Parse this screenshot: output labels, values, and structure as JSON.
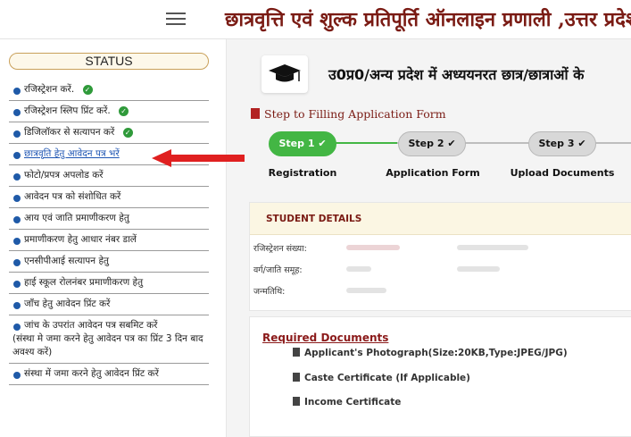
{
  "header": {
    "title": "छात्रवृत्ति एवं शुल्क प्रतिपूर्ति ऑनलाइन प्रणाली ,उत्तर प्रदेश"
  },
  "sidebar": {
    "status_label": "STATUS",
    "items": [
      {
        "label": "रजिस्ट्रेशन करें.",
        "done": true
      },
      {
        "label": "रजिस्ट्रेशन स्लिप प्रिंट करें.",
        "done": true
      },
      {
        "label": "डिजिलॉकर से सत्यापन करें",
        "done": true
      },
      {
        "label": "छात्रवृति हेतु आवेदन पत्र भरें",
        "done": false,
        "active": true
      },
      {
        "label": "फोटो/प्रपत्र अपलोड करें"
      },
      {
        "label": "आवेदन पत्र को संशोधित करें"
      },
      {
        "label": "आय एवं जाति प्रमाणीकरण हेतु"
      },
      {
        "label": "प्रमाणीकरण हेतु आधार नंबर डालें"
      },
      {
        "label": "एनसीपीआई सत्यापन हेतु"
      },
      {
        "label": "हाई स्कूल रोलनंबर प्रमाणीकरण हेतु"
      },
      {
        "label": "जाँच हेतु आवेदन प्रिंट करें"
      },
      {
        "label": "जांच के उपरांत आवेदन पत्र सबमिट करें",
        "note": "(संस्था मे जमा करने हेतु आवेदन पत्र का प्रिंट 3 दिन बाद अवश्य करें)"
      },
      {
        "label": "संस्था में जमा करने हेतु आवेदन प्रिंट करें"
      }
    ]
  },
  "main": {
    "heading": "उ0प्र0/अन्य प्रदेश में अध्ययनरत छात्र/छात्राओं के",
    "steps_title": "Step to Filling Application Form",
    "steps": [
      {
        "pill": "Step 1",
        "label": "Registration"
      },
      {
        "pill": "Step 2",
        "label": "Application Form"
      },
      {
        "pill": "Step 3",
        "label": "Upload Documents"
      }
    ],
    "student_details": {
      "title": "STUDENT DETAILS",
      "fields": [
        "रजिस्ट्रेशन संख्या:",
        "वर्ग/जाति समूह:",
        "जन्मतिथि:"
      ]
    },
    "required_documents": {
      "title": "Required Documents",
      "items": [
        "Applicant's Photograph(Size:20KB,Type:JPEG/JPG)",
        "Caste Certificate (If Applicable)",
        "Income Certificate"
      ]
    }
  },
  "colors": {
    "brand": "#7a1b14",
    "success": "#43b644",
    "link": "#1e55b3",
    "arrow": "#e02020"
  }
}
